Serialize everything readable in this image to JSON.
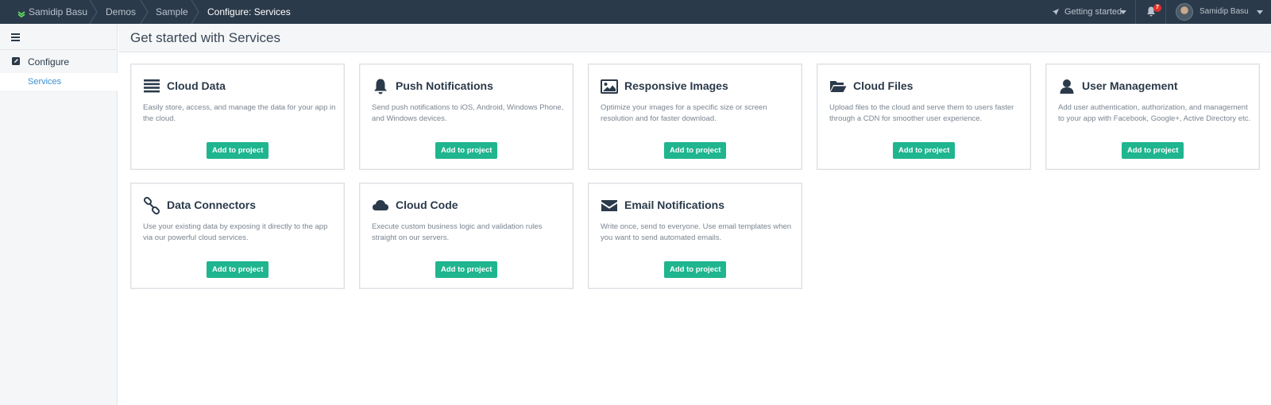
{
  "topbar": {
    "breadcrumbs": [
      {
        "label": "Samidip Basu"
      },
      {
        "label": "Demos"
      },
      {
        "label": "Sample"
      },
      {
        "label": "Configure: Services"
      }
    ],
    "getting_started": "Getting started",
    "notifications_count": "7",
    "user_name": "Samidip Basu"
  },
  "sidebar": {
    "section_label": "Configure",
    "items": [
      {
        "label": "Services"
      }
    ]
  },
  "page": {
    "title": "Get started with Services"
  },
  "cards": [
    {
      "title": "Cloud Data",
      "description": "Easily store, access, and manage the data for your app in the cloud.",
      "button": "Add to project",
      "icon": "database-icon"
    },
    {
      "title": "Push Notifications",
      "description": "Send push notifications to iOS, Android, Windows Phone, and Windows devices.",
      "button": "Add to project",
      "icon": "bell-icon"
    },
    {
      "title": "Responsive Images",
      "description": "Optimize your images for a specific size or screen resolution and for faster download.",
      "button": "Add to project",
      "icon": "image-icon"
    },
    {
      "title": "Cloud Files",
      "description": "Upload files to the cloud and serve them to users faster through a CDN for smoother user experience.",
      "button": "Add to project",
      "icon": "folder-open-icon"
    },
    {
      "title": "User Management",
      "description": "Add user authentication, authorization, and management to your app with Facebook, Google+, Active Directory etc.",
      "button": "Add to project",
      "icon": "user-icon"
    },
    {
      "title": "Data Connectors",
      "description": "Use your existing data by exposing it directly to the app via our powerful cloud services.",
      "button": "Add to project",
      "icon": "link-icon"
    },
    {
      "title": "Cloud Code",
      "description": "Execute custom business logic and validation rules straight on our servers.",
      "button": "Add to project",
      "icon": "cloud-icon"
    },
    {
      "title": "Email Notifications",
      "description": "Write once, send to everyone. Use email templates when you want to send automated emails.",
      "button": "Add to project",
      "icon": "envelope-icon"
    }
  ],
  "colors": {
    "topbar_bg": "#2b3a4a",
    "accent_button": "#1fb58f",
    "link_active": "#3d8fd1",
    "badge": "#e0322e"
  }
}
